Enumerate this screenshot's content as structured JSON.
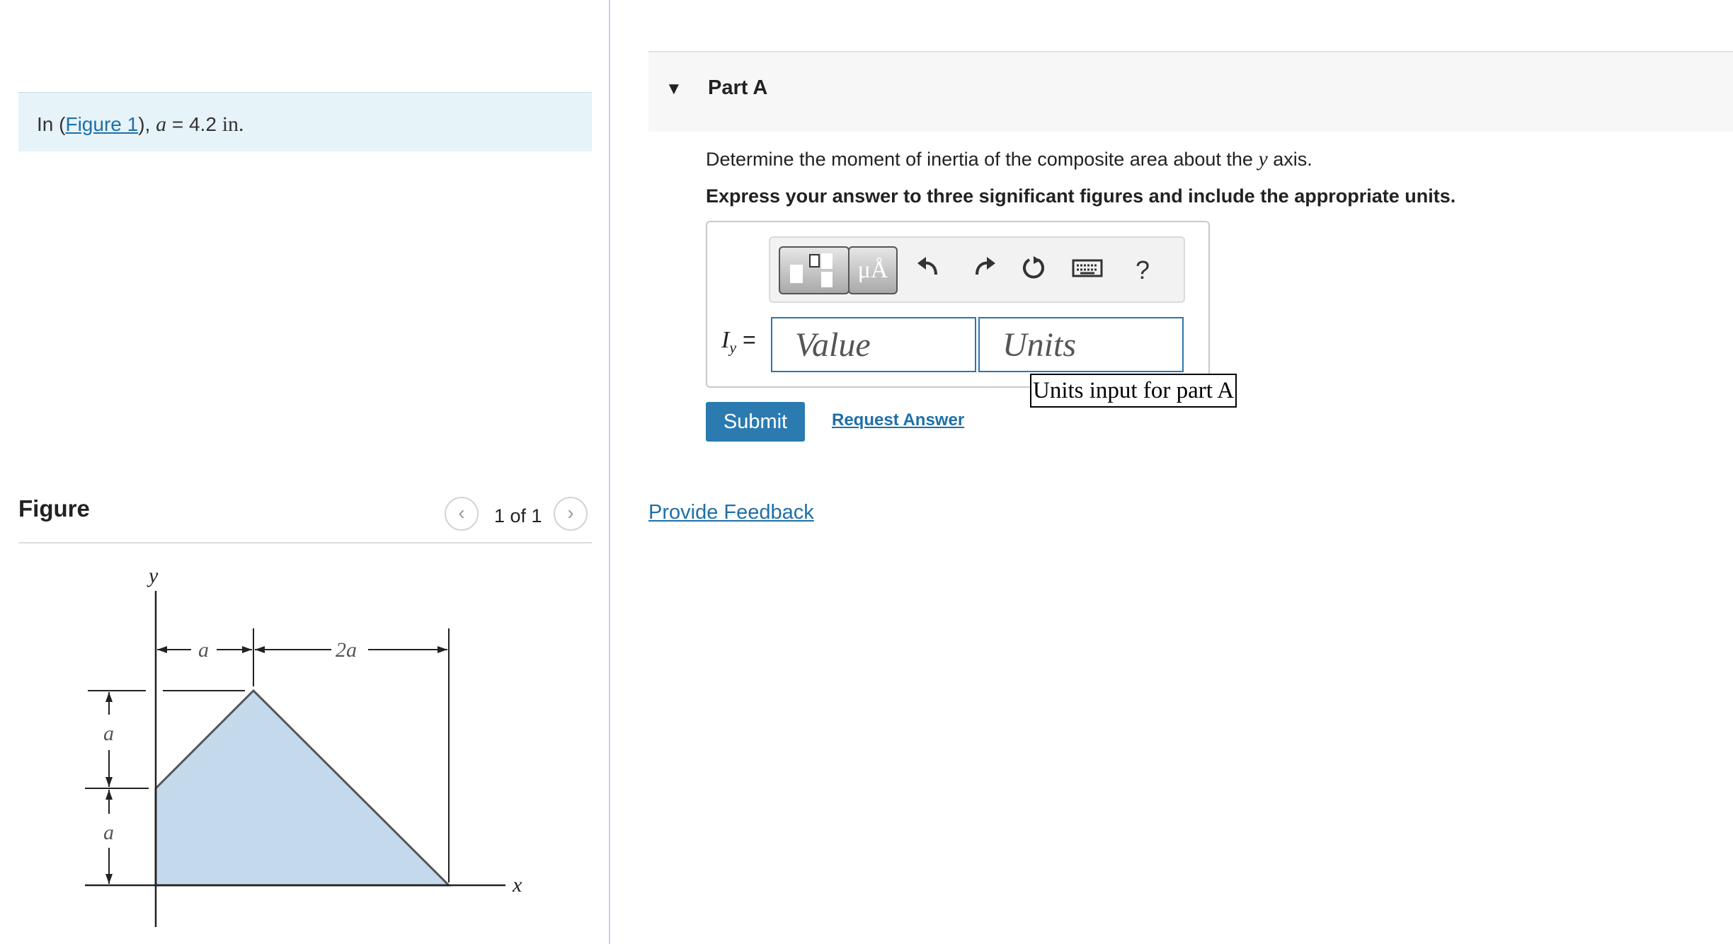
{
  "problem": {
    "prefix": "In (",
    "figure_link": "Figure 1",
    "suffix": "), ",
    "var": "a",
    "equals": " = 4.2 ",
    "unit": "in."
  },
  "figure_panel": {
    "title": "Figure",
    "counter": "1 of 1",
    "prev_glyph": "‹",
    "next_glyph": "›",
    "labels": {
      "y_axis": "y",
      "x_axis": "x",
      "dim_top_left": "a",
      "dim_top_right": "2a",
      "dim_left_upper": "a",
      "dim_left_lower": "a"
    },
    "shape_fill": "#c5d9ec"
  },
  "part_a": {
    "caret": "▼",
    "title": "Part A",
    "question_prefix": "Determine the moment of inertia of the composite area about the ",
    "question_var": "y",
    "question_suffix": " axis.",
    "instruction": "Express your answer to three significant figures and include the appropriate units.",
    "toolbar": {
      "symbols_label": "μÅ",
      "undo_icon": "undo-icon",
      "redo_icon": "redo-icon",
      "reset_icon": "reset-icon",
      "keyboard_icon": "keyboard-icon",
      "help_label": "?"
    },
    "answer_label_main": "I",
    "answer_label_sub": "y",
    "answer_label_eq": " =",
    "value_placeholder": "Value",
    "units_placeholder": "Units",
    "units_tooltip": "Units input for part A",
    "submit_label": "Submit",
    "request_answer_label": "Request Answer"
  },
  "feedback_link": "Provide Feedback",
  "colors": {
    "accent": "#2b7bb0",
    "link": "#1f6fa8",
    "problem_bg": "#e6f3f8"
  }
}
